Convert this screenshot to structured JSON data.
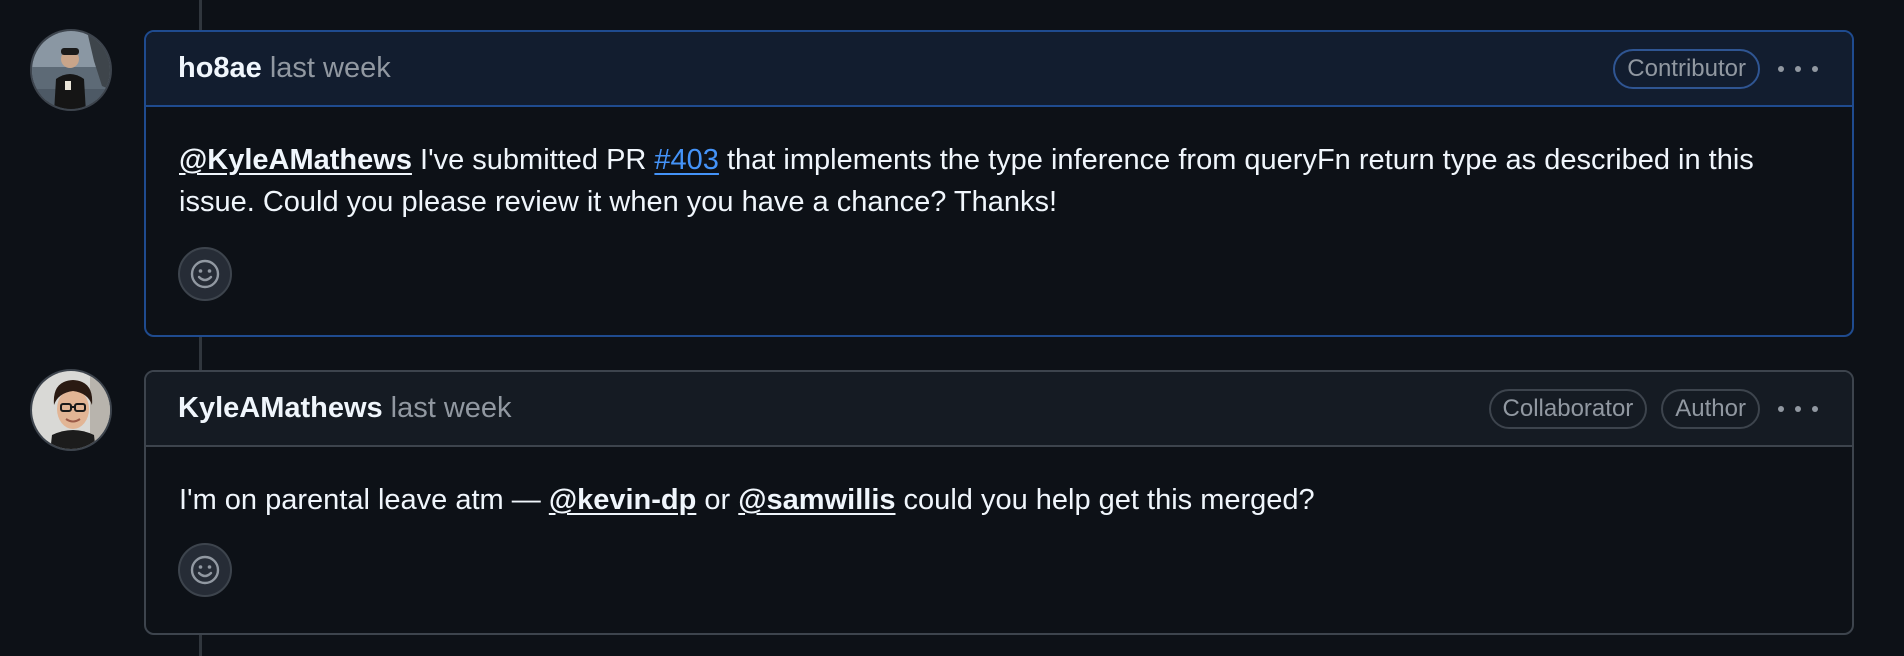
{
  "comments": [
    {
      "author": "ho8ae",
      "timestamp": "last week",
      "badges": [
        "Contributor"
      ],
      "body": {
        "mention": "@KyleAMathews",
        "text_before_link": " I've submitted PR ",
        "link": "#403",
        "text_after_link": " that implements the type inference from queryFn return type as described in this issue. Could you please review it when you have a chance? Thanks!"
      },
      "avatar_icon": "user-avatar"
    },
    {
      "author": "KyleAMathews",
      "timestamp": "last week",
      "badges": [
        "Collaborator",
        "Author"
      ],
      "body": {
        "text_before": "I'm on parental leave atm — ",
        "mention1": "@kevin-dp",
        "text_middle": " or ",
        "mention2": "@samwillis",
        "text_after": " could you help get this merged?"
      },
      "avatar_icon": "user-avatar"
    }
  ],
  "icons": {
    "reaction": "smiley-icon",
    "more": "kebab-horizontal-icon"
  },
  "colors": {
    "background": "#0d1117",
    "highlight_border": "#1f4b8f",
    "link": "#4493f8",
    "muted": "#9198a1"
  }
}
